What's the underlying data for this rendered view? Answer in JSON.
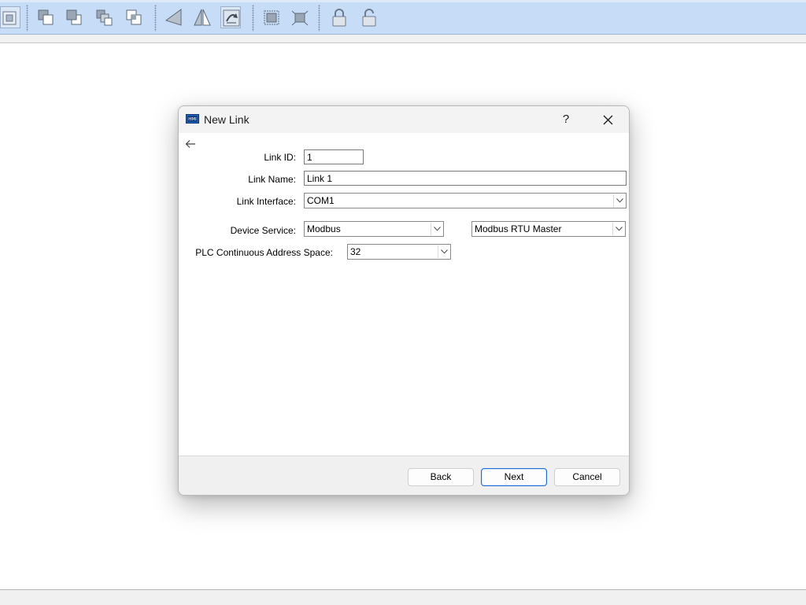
{
  "dialog": {
    "title": "New Link",
    "help_label": "?",
    "fields": {
      "link_id": {
        "label": "Link ID:",
        "value": "1"
      },
      "link_name": {
        "label": "Link Name:",
        "value": "Link 1"
      },
      "link_interface": {
        "label": "Link Interface:",
        "value": "COM1"
      },
      "device_service": {
        "label": "Device Service:",
        "value": "Modbus",
        "protocol_value": "Modbus RTU Master"
      },
      "plc_address_space": {
        "label": "PLC Continuous Address Space:",
        "value": "32"
      }
    },
    "buttons": {
      "back": "Back",
      "next": "Next",
      "cancel": "Cancel"
    }
  },
  "toolbar": {
    "icons": [
      "fit-view-icon",
      "bring-to-front-icon",
      "send-to-back-icon",
      "bring-forward-icon",
      "send-backward-icon",
      "flip-horizontal-icon",
      "flip-vertical-icon",
      "rotate-icon",
      "group-icon",
      "ungroup-icon",
      "lock-icon",
      "unlock-icon"
    ]
  },
  "colors": {
    "toolbar_bg": "#c7dcf7",
    "primary_border": "#1f6fd1",
    "footer_bg": "#f0f0f0"
  }
}
